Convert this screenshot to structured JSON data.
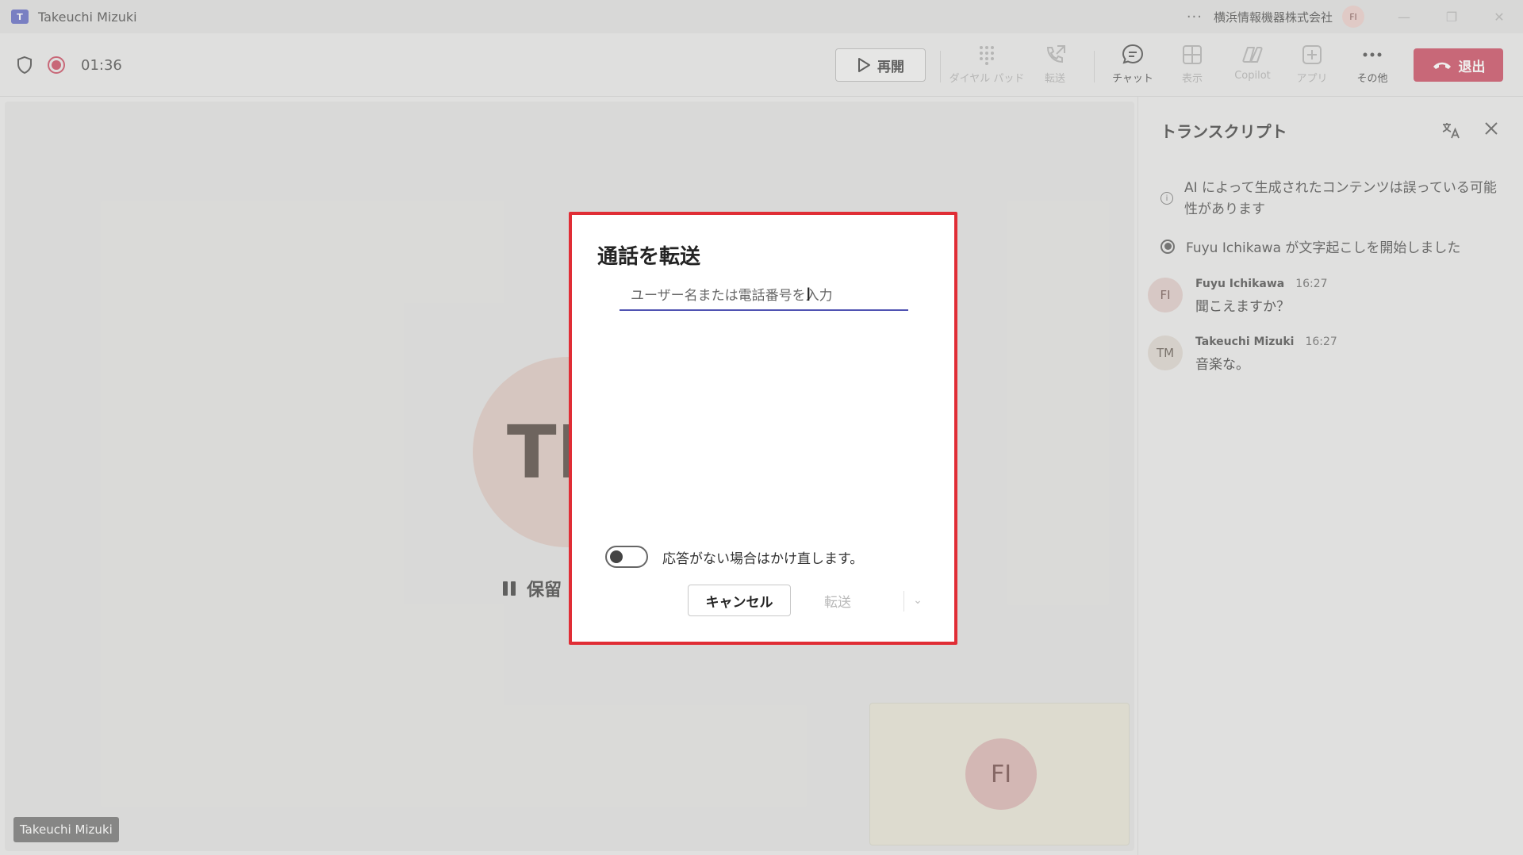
{
  "window": {
    "app_logo": "T",
    "title": "Takeuchi Mizuki",
    "more_icon": "···",
    "org": "横浜情報機器株式会社",
    "user_initials": "FI",
    "minimize": "—",
    "restore": "❐",
    "close": "✕"
  },
  "toolbar": {
    "timer": "01:36",
    "resume": "再開",
    "dialpad": "ダイヤル パッド",
    "transfer": "転送",
    "chat": "チャット",
    "view": "表示",
    "copilot": "Copilot",
    "apps": "アプリ",
    "more": "その他",
    "leave": "退出"
  },
  "stage": {
    "caller_initials": "TM",
    "hold_label": "保留",
    "self_initials": "FI",
    "name_tag": "Takeuchi Mizuki"
  },
  "transcript": {
    "title": "トランスクリプト",
    "ai_notice": "AI によって生成されたコンテンツは誤っている可能性があります",
    "started": "Fuyu Ichikawa が文字起こしを開始しました",
    "entries": [
      {
        "initials": "FI",
        "name": "Fuyu Ichikawa",
        "time": "16:27",
        "text": "聞こえますか？"
      },
      {
        "initials": "TM",
        "name": "Takeuchi Mizuki",
        "time": "16:27",
        "text": "音楽な。"
      }
    ]
  },
  "dialog": {
    "title": "通話を転送",
    "input_placeholder": "ユーザー名または電話番号を入力",
    "input_value": "",
    "retry_label": "応答がない場合はかけ直します。",
    "retry_enabled": false,
    "cancel": "キャンセル",
    "transfer": "転送"
  },
  "colors": {
    "accent": "#4f52b2",
    "leave": "#c4314b",
    "highlight_border": "#e02d35"
  }
}
